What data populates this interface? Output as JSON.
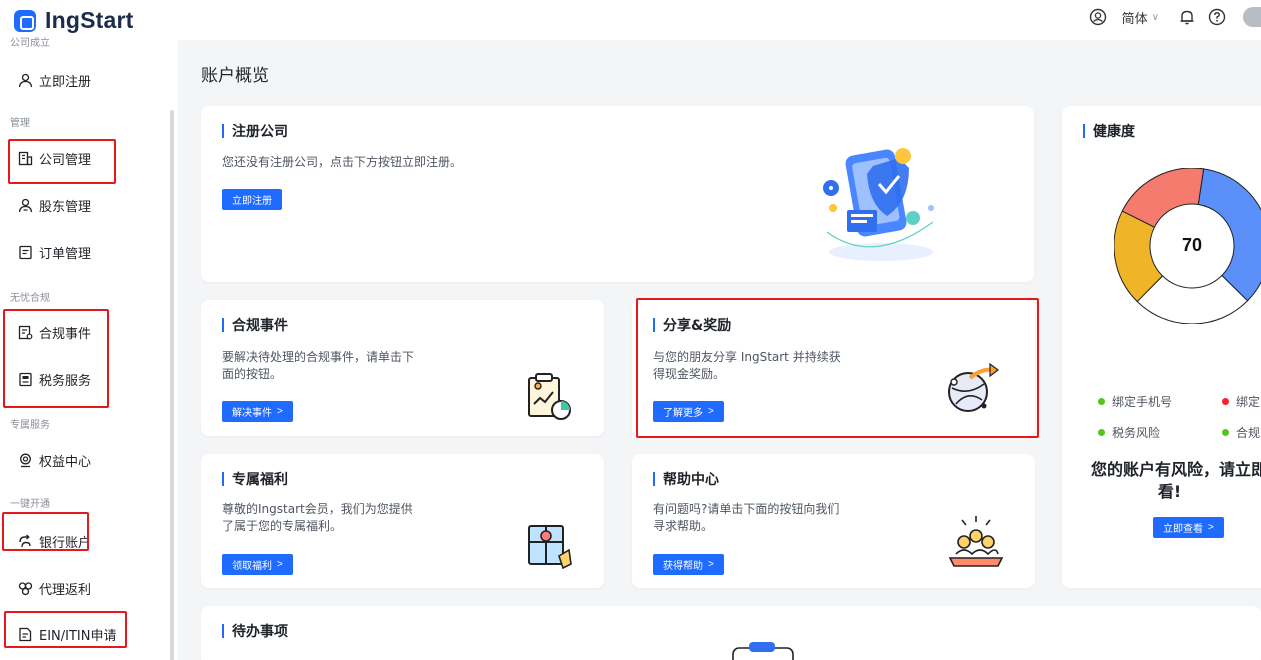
{
  "header": {
    "logo_text": "IngStart",
    "language": "简体",
    "icons": [
      "user-circle-icon",
      "bell-icon",
      "help-icon"
    ]
  },
  "sidebar": {
    "top_group": "公司成立",
    "register": "立即注册",
    "group_manage": "管理",
    "company_manage": "公司管理",
    "shareholder_manage": "股东管理",
    "order_manage": "订单管理",
    "group_compliance": "无忧合规",
    "compliance_events": "合规事件",
    "tax_service": "税务服务",
    "group_exclusive": "专属服务",
    "benefits_center": "权益中心",
    "group_oneclick": "一键开通",
    "bank_account": "银行账户",
    "agent_rebate": "代理返利",
    "ein_itin": "EIN/ITIN申请"
  },
  "main": {
    "page_title": "账户概览",
    "register_card": {
      "title": "注册公司",
      "desc": "您还没有注册公司，点击下方按钮立即注册。",
      "button": "立即注册"
    },
    "compliance_card": {
      "title": "合规事件",
      "desc_line1": "要解决待处理的合规事件，请单击下",
      "desc_line2": "面的按钮。",
      "button": "解决事件"
    },
    "share_card": {
      "title": "分享&奖励",
      "desc_line1": "与您的朋友分享 IngStart 并持续获",
      "desc_line2": "得现金奖励。",
      "button": "了解更多"
    },
    "benefit_card": {
      "title": "专属福利",
      "desc_line1": "尊敬的Ingstart会员，我们为您提供",
      "desc_line2": "了属于您的专属福利。",
      "button": "领取福利"
    },
    "help_card": {
      "title": "帮助中心",
      "desc_line1": "有问题吗?请单击下面的按钮向我们",
      "desc_line2": "寻求帮助。",
      "button": "获得帮助"
    },
    "todo_card": {
      "title": "待办事项"
    },
    "button_arrow": ">"
  },
  "health": {
    "title": "健康度",
    "score": "70",
    "legend": [
      {
        "label": "绑定手机号",
        "color": "#52c41a"
      },
      {
        "label": "绑定邮",
        "color": "#f5222d"
      },
      {
        "label": "税务风险",
        "color": "#52c41a"
      },
      {
        "label": "合规",
        "color": "#52c41a"
      }
    ],
    "risk_line1": "您的账户有风险，请立即查",
    "risk_line2": "看!",
    "button": "立即查看",
    "donut_segments": [
      {
        "color": "#5b8ff9",
        "percent": 35
      },
      {
        "color": "#ffffff",
        "percent": 25
      },
      {
        "color": "#f0b429",
        "percent": 20
      },
      {
        "color": "#f47b6e",
        "percent": 20
      }
    ]
  },
  "colors": {
    "accent": "#1f6bff",
    "highlight": "#e4191c"
  }
}
